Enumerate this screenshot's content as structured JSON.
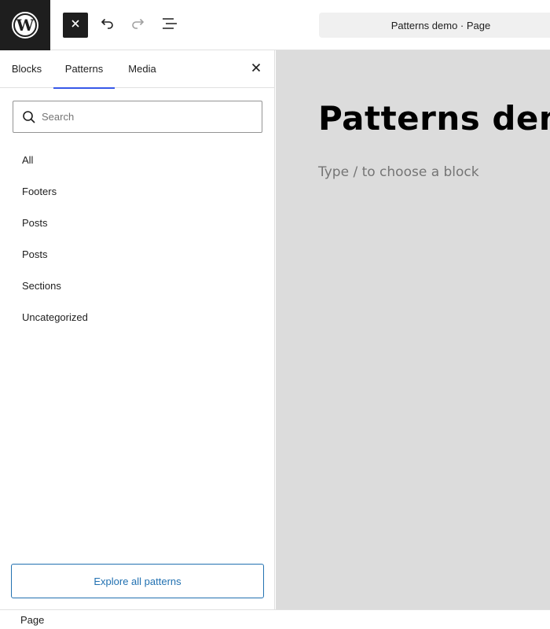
{
  "toolbar": {
    "document_title": "Patterns demo · Page"
  },
  "icons": {
    "logo": "wordpress-logo",
    "close_inserter": "close-icon",
    "undo": "undo-icon",
    "redo": "redo-icon",
    "document_overview": "list-view-icon"
  },
  "inserter": {
    "tabs": [
      {
        "label": "Blocks",
        "active": false
      },
      {
        "label": "Patterns",
        "active": true
      },
      {
        "label": "Media",
        "active": false
      }
    ],
    "search": {
      "placeholder": "Search",
      "value": ""
    },
    "categories": [
      "All",
      "Footers",
      "Posts",
      "Posts",
      "Sections",
      "Uncategorized"
    ],
    "explore_label": "Explore all patterns"
  },
  "canvas": {
    "title": "Patterns demo",
    "placeholder": "Type / to choose a block"
  },
  "footer": {
    "breadcrumb": "Page"
  },
  "colors": {
    "accent": "#3858e9",
    "link": "#2271b1",
    "dark": "#1e1e1e",
    "canvas_bg": "#dcdcdc"
  }
}
